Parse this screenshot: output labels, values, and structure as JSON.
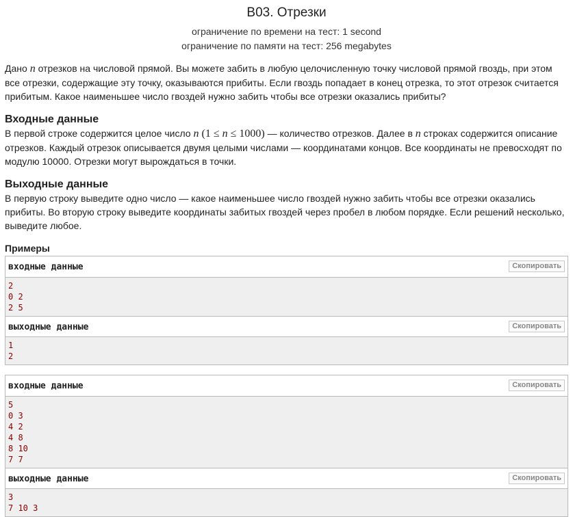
{
  "header": {
    "title": "B03. Отрезки",
    "time_limit": "ограничение по времени на тест: 1 second",
    "memory_limit": "ограничение по памяти на тест: 256 megabytes"
  },
  "legend": {
    "p1_a": "Дано ",
    "p1_var": "n",
    "p1_b": " отрезков на числовой прямой. Вы можете забить в любую целочисленную точку числовой прямой гвоздь, при этом все отрезки, содержащие эту точку, оказываются прибиты. Если гвоздь попадает в конец отрезка, то этот отрезок считается прибитым. Какое наименьшее число гвоздей нужно забить чтобы все отрезки оказались прибиты?"
  },
  "input_spec": {
    "title": "Входные данные",
    "a": "В первой строке содержится целое число ",
    "var_n": "n",
    "constraint_open": " (1 ≤ ",
    "constraint_var": "n",
    "constraint_close": " ≤ 1000)",
    "b": " — количество отрезков. Далее в ",
    "var_n2": "n",
    "c": " строках содержится описание отрезков. Каждый отрезок описывается двумя целыми числами — координатами концов. Все координаты не превосходят по модулю 10000. Отрезки могут вырождаться в точки."
  },
  "output_spec": {
    "title": "Выходные данные",
    "text": "В первую строку выведите одно число — какое наименьшее число гвоздей нужно забить чтобы все отрезки оказались прибиты. Во вторую строку выведите координаты забитых гвоздей через пробел в любом порядке. Если решений несколько, выведите любое."
  },
  "examples": {
    "title": "Примеры",
    "input_label": "входные данные",
    "output_label": "выходные данные",
    "copy_label": "Скопировать",
    "list": [
      {
        "input": [
          "2",
          "0 2",
          "2 5"
        ],
        "output": [
          "1",
          "2"
        ]
      },
      {
        "input": [
          "5",
          "0 3",
          "4 2",
          "4 8",
          "8 10",
          "7 7"
        ],
        "output": [
          "3",
          "7 10 3"
        ]
      }
    ]
  }
}
